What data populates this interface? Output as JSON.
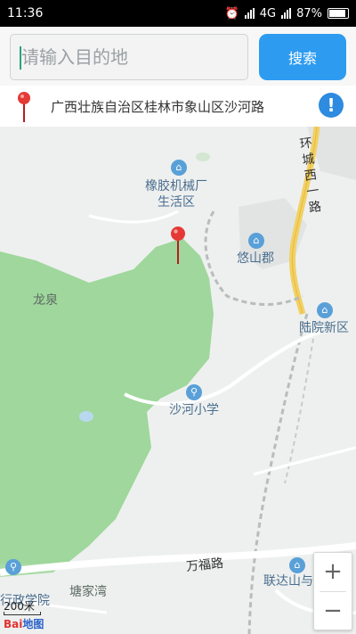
{
  "status_bar": {
    "time": "11:36",
    "network": "4G",
    "battery": "87%"
  },
  "search": {
    "placeholder": "请输入目的地",
    "button_label": "搜索"
  },
  "location": {
    "address": "广西壮族自治区桂林市象山区沙河路",
    "info_icon": "!"
  },
  "map": {
    "labels": {
      "rubber_factory_line1": "橡胶机械厂",
      "rubber_factory_line2": "生活区",
      "youshan": "悠山郡",
      "longquan": "龙泉",
      "luyuan": "陆院新区",
      "shahe_school": "沙河小学",
      "ring_road": "环城西一路",
      "wanfu_road": "万福路",
      "liandashan": "联达山与",
      "tangjiawan": "塘家湾",
      "admin_school": "行政学院"
    },
    "scale_text": "200米",
    "logo_text": "Bai",
    "logo_text2": "地图"
  },
  "zoom": {
    "in": "+",
    "out": "−"
  }
}
